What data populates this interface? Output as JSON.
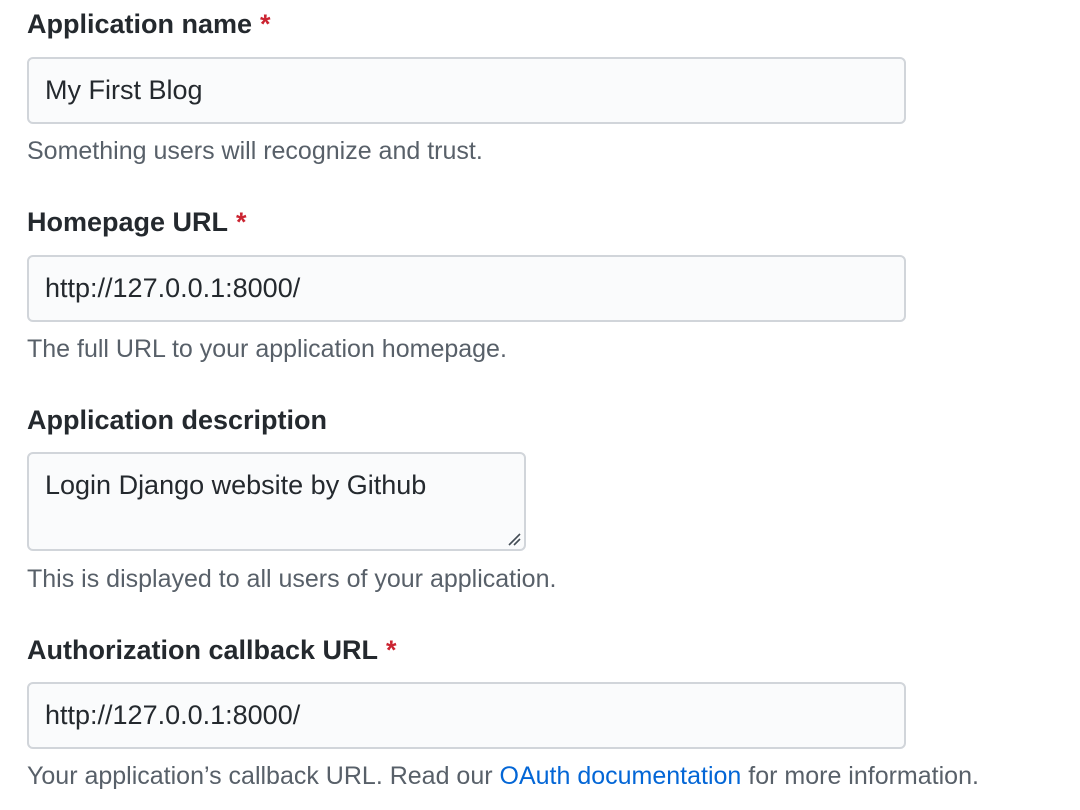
{
  "fields": {
    "app_name": {
      "label": "Application name",
      "required_mark": "*",
      "value": "My First Blog",
      "note": "Something users will recognize and trust."
    },
    "homepage_url": {
      "label": "Homepage URL",
      "required_mark": "*",
      "value": "http://127.0.0.1:8000/",
      "note": "The full URL to your application homepage."
    },
    "description": {
      "label": "Application description",
      "value": "Login Django website by Github",
      "note": "This is displayed to all users of your application."
    },
    "callback_url": {
      "label": "Authorization callback URL",
      "required_mark": "*",
      "value": "http://127.0.0.1:8000/",
      "note_prefix": "Your application’s callback URL. Read our ",
      "note_link": "OAuth documentation",
      "note_suffix": " for more information."
    }
  },
  "colors": {
    "required": "#cb2431",
    "link": "#0366d6",
    "note": "#586069",
    "input_bg": "#fafbfc",
    "input_border": "#d1d5da"
  },
  "icons": {
    "textarea_resize": "resize-grip-icon"
  }
}
